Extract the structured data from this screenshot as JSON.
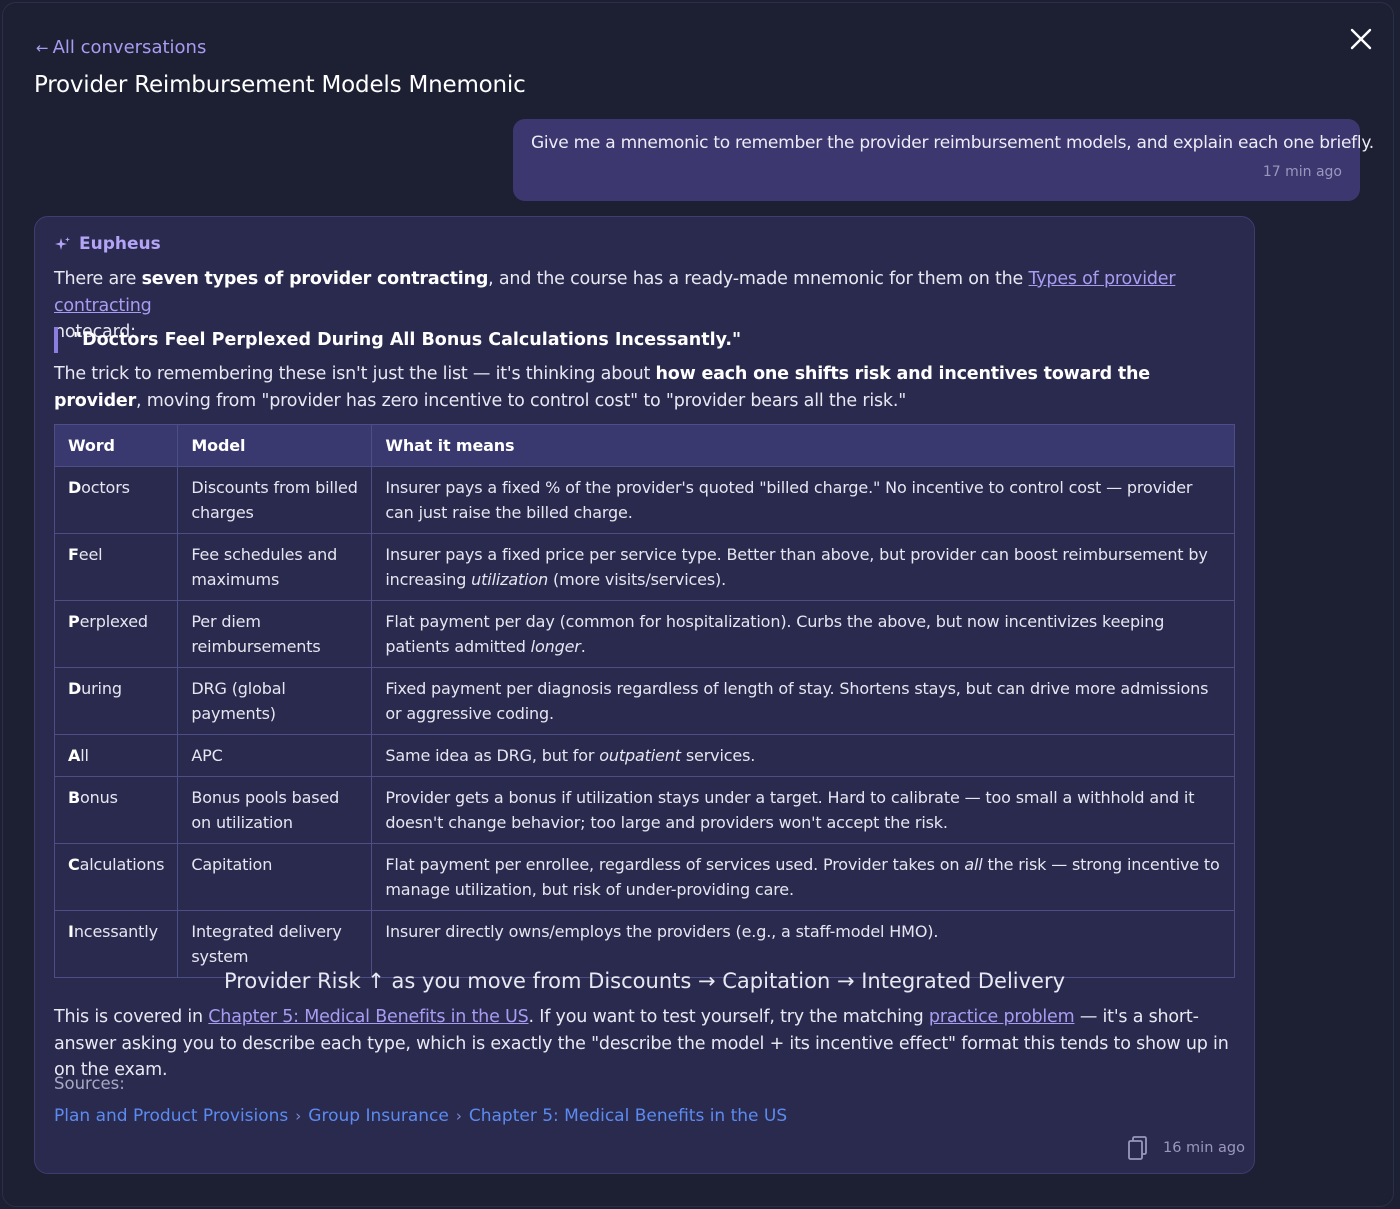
{
  "header": {
    "back_label": "All conversations",
    "title": "Provider Reimbursement Models Mnemonic"
  },
  "user_message": {
    "text": "Give me a mnemonic to remember the provider reimbursement models, and explain each one briefly.",
    "time": "17 min ago"
  },
  "assistant": {
    "name": "Eupheus",
    "intro_1": "There are ",
    "intro_bold": "seven types of provider contracting",
    "intro_2": ", and the course has a ready-made mnemonic for them on the ",
    "intro_link": "Types of provider contracting",
    "intro_3": " notecard:",
    "quote": "\"Doctors Feel Perplexed During All Bonus Calculations Incessantly.\"",
    "trick_1": "The trick to remembering these isn't just the list — it's thinking about ",
    "trick_bold": "how each one shifts risk and incentives toward the provider",
    "trick_2": ", moving from \"provider has zero incentive to control cost\" to \"provider bears all the risk.\"",
    "table": {
      "headers": [
        "Word",
        "Model",
        "What it means"
      ],
      "rows": [
        {
          "first": "D",
          "rest": "octors",
          "model": "Discounts from billed charges",
          "m1": "Insurer pays a fixed % of the provider's quoted \"billed charge.\" No incentive to control cost — provider can just raise the billed charge.",
          "em": "",
          "m2": ""
        },
        {
          "first": "F",
          "rest": "eel",
          "model": "Fee schedules and maximums",
          "m1": "Insurer pays a fixed price per service type. Better than above, but provider can boost reimbursement by increasing ",
          "em": "utilization",
          "m2": " (more visits/services)."
        },
        {
          "first": "P",
          "rest": "erplexed",
          "model": "Per diem reimbursements",
          "m1": "Flat payment per day (common for hospitalization). Curbs the above, but now incentivizes keeping patients admitted ",
          "em": "longer",
          "m2": "."
        },
        {
          "first": "D",
          "rest": "uring",
          "model": "DRG (global payments)",
          "m1": "Fixed payment per diagnosis regardless of length of stay. Shortens stays, but can drive more admissions or aggressive coding.",
          "em": "",
          "m2": ""
        },
        {
          "first": "A",
          "rest": "ll",
          "model": "APC",
          "m1": "Same idea as DRG, but for ",
          "em": "outpatient",
          "m2": " services."
        },
        {
          "first": "B",
          "rest": "onus",
          "model": "Bonus pools based on utilization",
          "m1": "Provider gets a bonus if utilization stays under a target. Hard to calibrate — too small a withhold and it doesn't change behavior; too large and providers won't accept the risk.",
          "em": "",
          "m2": ""
        },
        {
          "first": "C",
          "rest": "alculations",
          "model": "Capitation",
          "m1": "Flat payment per enrollee, regardless of services used. Provider takes on ",
          "em": "all",
          "m2": " the risk — strong incentive to manage utilization, but risk of under-providing care."
        },
        {
          "first": "I",
          "rest": "ncessantly",
          "model": "Integrated delivery system",
          "m1": "Insurer directly owns/employs the providers (e.g., a staff-model HMO).",
          "em": "",
          "m2": ""
        }
      ]
    },
    "risk_line": "Provider Risk ↑  as you move from Discounts → Capitation → Integrated Delivery",
    "outro_1": "This is covered in ",
    "outro_link_1": "Chapter 5: Medical Benefits in the US",
    "outro_2": ". If you want to test yourself, try the matching ",
    "outro_link_2": "practice problem",
    "outro_3": " — it's a short-answer asking you to describe each type, which is exactly the \"describe the model + its incentive effect\" format this tends to show up in on the exam.",
    "sources_label": "Sources:",
    "sources": [
      "Plan and Product Provisions",
      "Group Insurance",
      "Chapter 5: Medical Benefits in the US"
    ],
    "time": "16 min ago"
  },
  "icons": {
    "back": "left-arrow-icon",
    "close": "close-icon",
    "assistant": "sparkle-icon",
    "copy": "copy-icon"
  },
  "colors": {
    "background": "#1d1f33",
    "accent": "#a79cf0",
    "user_bubble": "#3d3770",
    "card": "#2a2a4f",
    "link_blue": "#5b8bf0"
  }
}
